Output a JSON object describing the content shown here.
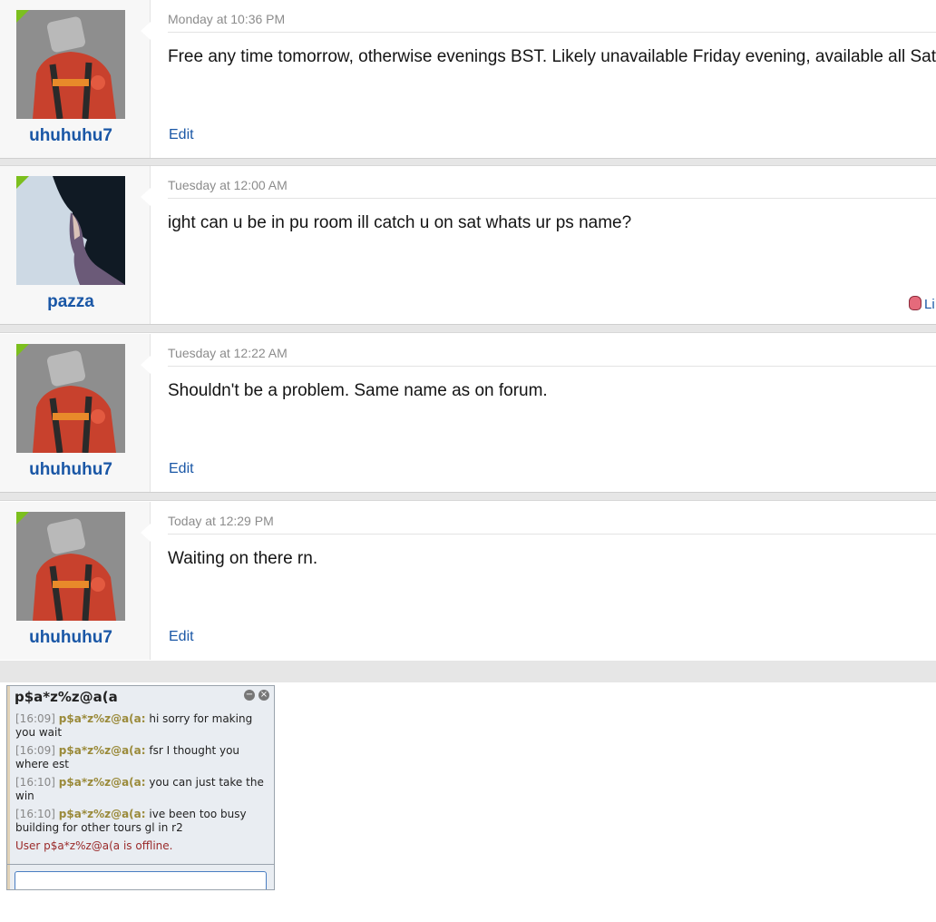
{
  "posts": [
    {
      "user": "uhuhuhu7",
      "date": "Monday at 10:36 PM",
      "message": "Free any time tomorrow, otherwise evenings BST. Likely unavailable Friday evening, available all Sat & S",
      "action": "Edit"
    },
    {
      "user": "pazza",
      "date": "Tuesday at 12:00 AM",
      "message": "ight can u be in pu room ill catch u on sat whats ur ps name?",
      "action": "Li"
    },
    {
      "user": "uhuhuhu7",
      "date": "Tuesday at 12:22 AM",
      "message": "Shouldn't be a problem. Same name as on forum.",
      "action": "Edit"
    },
    {
      "user": "uhuhuhu7",
      "date": "Today at 12:29 PM",
      "message": "Waiting on there rn.",
      "action": "Edit"
    }
  ],
  "chat": {
    "title": "p$a*z%z@a(a",
    "minimize_icon": "minimize-icon",
    "close_icon": "close-icon",
    "messages": [
      {
        "time": "[16:09]",
        "sender": "p$a*z%z@a(a:",
        "text": "hi sorry for making you wait"
      },
      {
        "time": "[16:09]",
        "sender": "p$a*z%z@a(a:",
        "text": "fsr I thought you where est"
      },
      {
        "time": "[16:10]",
        "sender": "p$a*z%z@a(a:",
        "text": "you can just take the win"
      },
      {
        "time": "[16:10]",
        "sender": "p$a*z%z@a(a:",
        "text": "ive been too busy building for other tours gl in r2"
      }
    ],
    "status": "User p$a*z%z@a(a is offline.",
    "input_value": ""
  },
  "colors": {
    "username": "#1a57a6",
    "online_flag": "#7cbf1e",
    "chat_sender": "#9a8a3a",
    "offline": "#9a2a2a"
  }
}
